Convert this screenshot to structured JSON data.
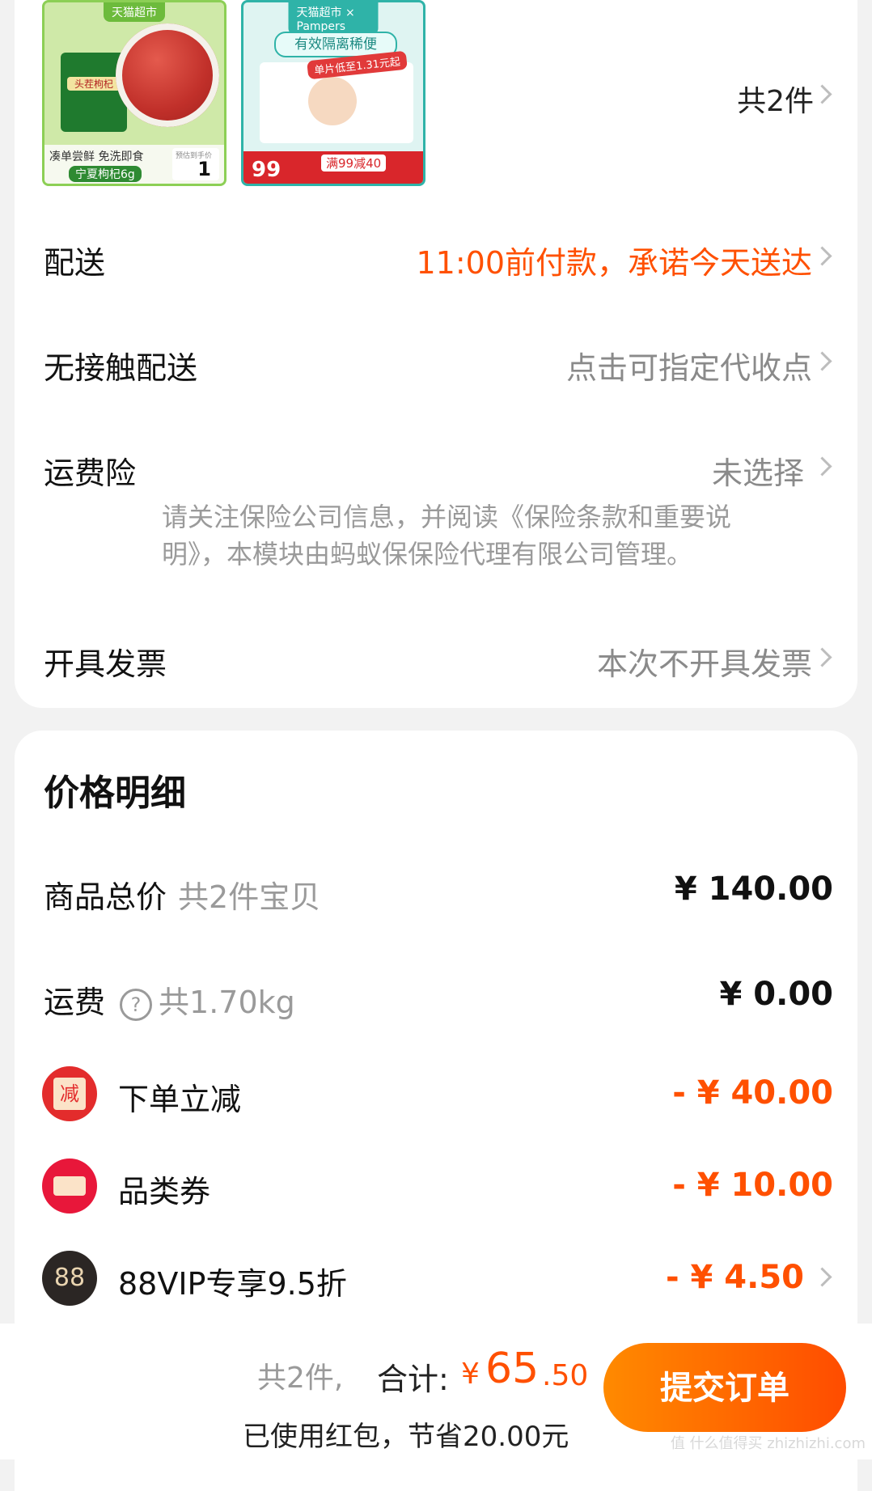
{
  "order_items": {
    "item1": {
      "store_tag": "天猫超市",
      "slogan": "凑单尝鲜 免洗即食",
      "name": "宁夏枸杞6g",
      "bag_label": "头茬枸杞",
      "price_caption": "预估到手价",
      "price": "1"
    },
    "item2": {
      "store_tag": "天猫超市 × Pampers",
      "banner": "有效隔离稀便",
      "unit_tag": "单片低至1.31元起",
      "price": "99",
      "promo": "满99减40"
    },
    "count_label": "共2件"
  },
  "rows": {
    "delivery": {
      "label": "配送",
      "value": "11:00前付款，承诺今天送达"
    },
    "contactless": {
      "label": "无接触配送",
      "value": "点击可指定代收点"
    },
    "insurance": {
      "label": "运费险",
      "value": "未选择",
      "note": "请关注保险公司信息，并阅读《保险条款和重要说明》，本模块由蚂蚁保保险代理有限公司管理。"
    },
    "invoice": {
      "label": "开具发票",
      "value": "本次不开具发票"
    }
  },
  "price_detail": {
    "title": "价格明细",
    "goods_total": {
      "label": "商品总价",
      "sub": "共2件宝贝",
      "amount": "¥ 140.00"
    },
    "shipping": {
      "label": "运费",
      "sub": "共1.70kg",
      "amount": "¥ 0.00",
      "help": "?"
    },
    "discounts": [
      {
        "label": "下单立减",
        "amount": "- ¥ 40.00",
        "icon": "reduce-icon",
        "icon_text": "减",
        "color": "#e32c2c"
      },
      {
        "label": "品类券",
        "amount": "- ¥ 10.00",
        "icon": "coupon-icon",
        "icon_text": "",
        "color": "#e8173a"
      },
      {
        "label": "88VIP专享9.5折",
        "amount": "- ¥ 4.50",
        "icon": "vip-88-icon",
        "icon_text": "88",
        "color": "#2b2624"
      }
    ]
  },
  "bottom_bar": {
    "count": "共2件,",
    "total_label": "合计:",
    "currency": "¥",
    "total_int": "65",
    "total_dec": ".50",
    "red_packet_note": "已使用红包，节省20.00元",
    "submit_label": "提交订单"
  },
  "watermark": "值 什么值得买 zhizhizhi.com",
  "colors": {
    "accent": "#ff5000",
    "muted": "#8a8a8a"
  }
}
